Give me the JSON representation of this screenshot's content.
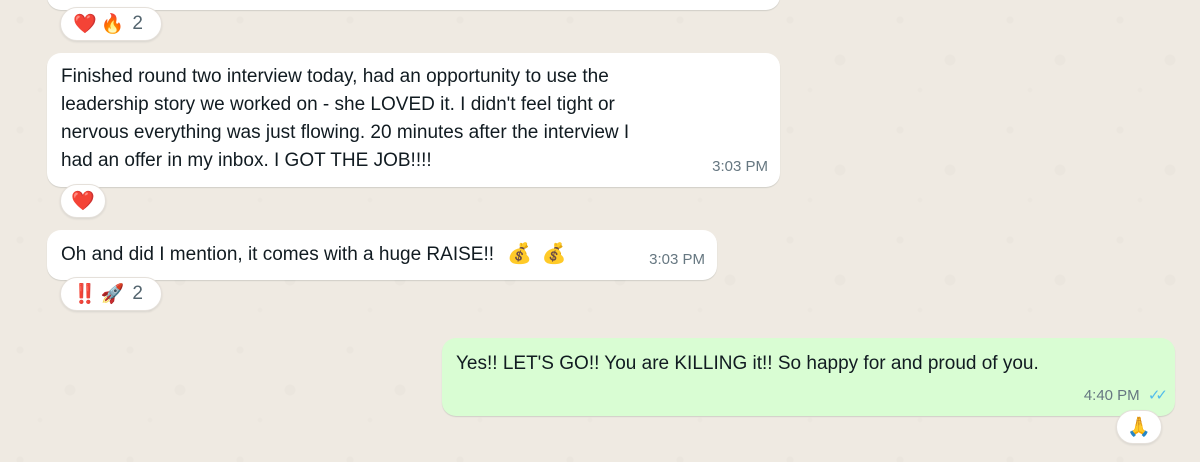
{
  "messages": [
    {
      "id": "m0",
      "direction": "incoming",
      "text": "",
      "time": "",
      "reactions": [
        "❤️",
        "🔥"
      ],
      "reaction_count": "2"
    },
    {
      "id": "m1",
      "direction": "incoming",
      "lines": [
        "Finished round two interview today, had an opportunity to use the",
        "leadership story we worked on - she LOVED it. I didn't feel tight or",
        "nervous everything was just flowing. 20 minutes after the interview I",
        "had an offer in my inbox. I GOT THE JOB!!!!"
      ],
      "time": "3:03 PM",
      "reactions": [
        "❤️"
      ]
    },
    {
      "id": "m2",
      "direction": "incoming",
      "text": "Oh and did I mention, it comes with a huge RAISE!!",
      "emojis": [
        "💰",
        "💰"
      ],
      "time": "3:03 PM",
      "reactions": [
        "‼️",
        "🚀"
      ],
      "reaction_count": "2"
    },
    {
      "id": "m3",
      "direction": "outgoing",
      "text": "Yes!! LET'S GO!! You are KILLING it!! So happy for and proud of you.",
      "time": "4:40 PM",
      "ticks": "✓✓",
      "reactions": [
        "🙏"
      ]
    }
  ],
  "colors": {
    "wallpaper": "#efeae2",
    "incoming_bubble": "#ffffff",
    "outgoing_bubble": "#d9fdd3",
    "read_ticks": "#53bdeb",
    "meta_text": "#667781"
  }
}
